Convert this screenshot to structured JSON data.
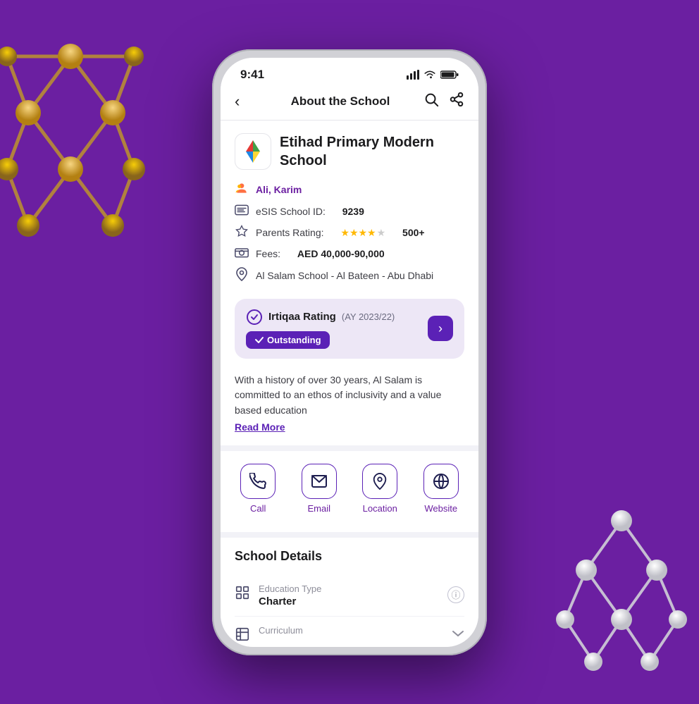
{
  "status": {
    "time": "9:41",
    "signal": "▂▄▆",
    "wifi": "wifi",
    "battery": "battery"
  },
  "nav": {
    "back_label": "‹",
    "title": "About the School",
    "search_icon": "search",
    "share_icon": "share"
  },
  "school": {
    "name": "Etihad Primary Modern School",
    "person_name": "Ali, Karim",
    "esis_label": "eSIS School ID:",
    "esis_value": "9239",
    "rating_label": "Parents Rating:",
    "rating_count": "500+",
    "fees_label": "Fees:",
    "fees_value": "AED 40,000-90,000",
    "address": "Al Salam School - Al Bateen - Abu Dhabi"
  },
  "irtiqaa": {
    "title": "Irtiqaa Rating",
    "year": "(AY 2023/22)",
    "badge": "Outstanding"
  },
  "description": {
    "text": "With a history of over 30 years, Al Salam is committed to an ethos of inclusivity and a value based education",
    "read_more": "Read More"
  },
  "actions": {
    "call": "Call",
    "email": "Email",
    "location": "Location",
    "website": "Website"
  },
  "school_details": {
    "title": "School Details",
    "items": [
      {
        "icon": "grid",
        "label": "Education Type",
        "value": "Charter",
        "accessory": "info"
      },
      {
        "icon": "curriculum",
        "label": "Curriculum",
        "value": "",
        "accessory": "expand"
      }
    ]
  },
  "colors": {
    "brand_purple": "#6B1FA1",
    "deep_purple": "#5B21B6",
    "light_purple_bg": "#EDE7F6"
  }
}
